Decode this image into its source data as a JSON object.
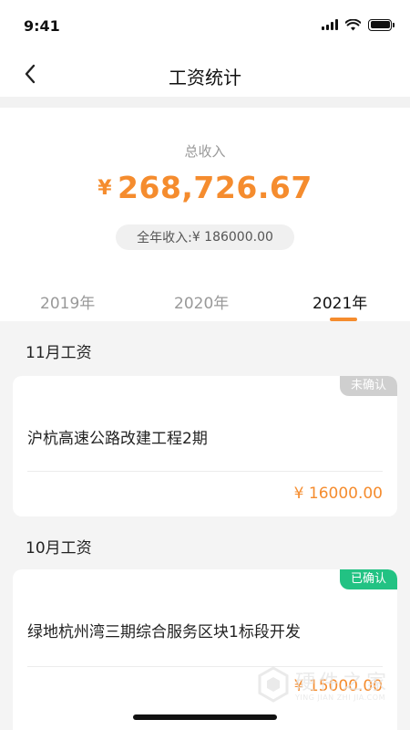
{
  "status_bar": {
    "time": "9:41"
  },
  "header": {
    "title": "工资统计"
  },
  "summary": {
    "total_label": "总收入",
    "currency_symbol": "¥",
    "total_amount": "268,726.67",
    "annual_label": "全年收入:",
    "annual_amount": "¥ 186000.00"
  },
  "year_tabs": [
    {
      "label": "2019年",
      "active": false
    },
    {
      "label": "2020年",
      "active": false
    },
    {
      "label": "2021年",
      "active": true
    }
  ],
  "months": [
    {
      "title": "11月工资",
      "status": "未确认",
      "status_color": "#cfcfcf",
      "project": "沪杭高速公路改建工程2期",
      "amount": "¥ 16000.00"
    },
    {
      "title": "10月工资",
      "status": "已确认",
      "status_color": "#22c283",
      "project": "绿地杭州湾三期综合服务区块1标段开发",
      "amount": "¥ 15000.00"
    }
  ],
  "watermark": {
    "text": "硬件之家",
    "subtext": "YING JIAN ZHI JIA.COM"
  },
  "colors": {
    "accent": "#f58c2e",
    "confirmed": "#22c283",
    "unconfirmed": "#cfcfcf"
  }
}
